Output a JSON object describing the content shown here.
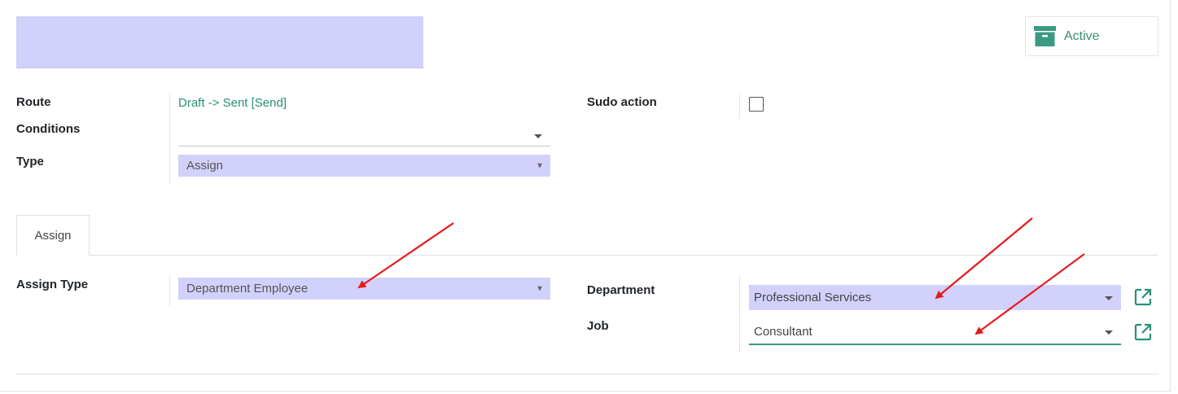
{
  "header": {
    "active_label": "Active"
  },
  "fields": {
    "route": {
      "label": "Route",
      "value": "Draft -> Sent [Send]"
    },
    "conditions": {
      "label": "Conditions",
      "value": ""
    },
    "type": {
      "label": "Type",
      "value": "Assign"
    },
    "sudo_action": {
      "label": "Sudo action",
      "checked": false
    }
  },
  "tabs": [
    {
      "label": "Assign",
      "active": true
    }
  ],
  "assign": {
    "assign_type": {
      "label": "Assign Type",
      "value": "Department Employee"
    },
    "department": {
      "label": "Department",
      "value": "Professional Services"
    },
    "job": {
      "label": "Job",
      "value": "Consultant"
    }
  },
  "colors": {
    "accent": "#2a9078",
    "field_bg": "#d1d1fb",
    "annotation_arrow": "#e8191c"
  },
  "icons": {
    "active": "archive-box-icon",
    "external": "external-link-icon"
  }
}
